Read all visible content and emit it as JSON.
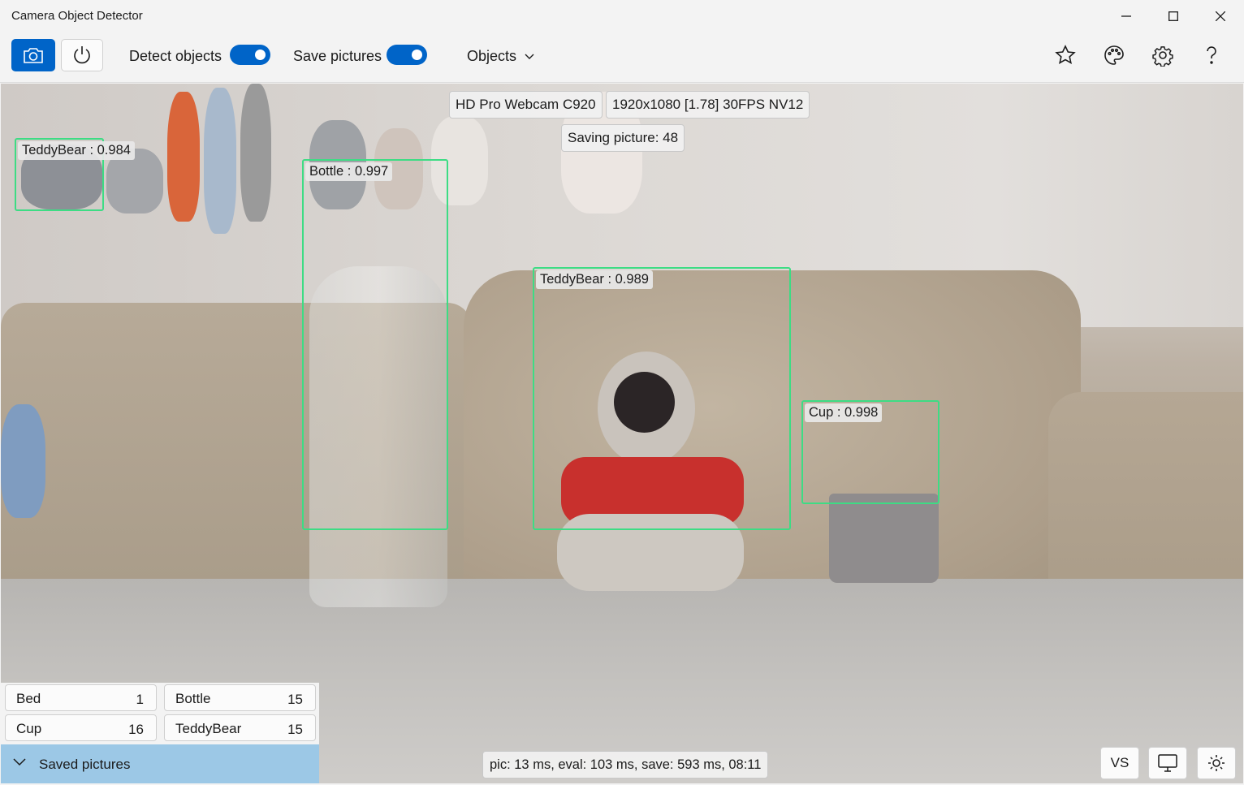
{
  "window": {
    "title": "Camera Object Detector",
    "minimize_icon": "minimize-icon",
    "maximize_icon": "maximize-icon",
    "close_icon": "close-icon"
  },
  "toolbar": {
    "camera_icon": "camera-icon",
    "power_icon": "power-icon",
    "detect_objects_label": "Detect objects",
    "detect_objects_on": true,
    "save_pictures_label": "Save pictures",
    "save_pictures_on": true,
    "objects_label": "Objects",
    "right_icons": [
      "star-icon",
      "palette-icon",
      "gear-icon",
      "help-icon"
    ],
    "accent_color": "#0064c8"
  },
  "camera": {
    "device": "HD Pro Webcam C920",
    "format": "1920x1080 [1.78] 30FPS NV12",
    "saving": "Saving picture: 48",
    "box_color": "#3ddc84",
    "detections": [
      {
        "label": "TeddyBear : 0.984"
      },
      {
        "label": "Bottle : 0.997"
      },
      {
        "label": "TeddyBear : 0.989"
      },
      {
        "label": "Cup : 0.998"
      }
    ]
  },
  "counts": [
    {
      "name": "Bed",
      "count": "1"
    },
    {
      "name": "Bottle",
      "count": "15"
    },
    {
      "name": "Cup",
      "count": "16"
    },
    {
      "name": "TeddyBear",
      "count": "15"
    }
  ],
  "saved_pictures": {
    "label": "Saved pictures",
    "expander_icon": "chevron-down-icon",
    "color": "#9cc8e6"
  },
  "status_text": "pic: 13 ms, eval: 103 ms, save: 593 ms, 08:11",
  "bottom_buttons": {
    "vs_label": "VS",
    "monitor_icon": "monitor-icon",
    "brightness_icon": "brightness-icon"
  }
}
